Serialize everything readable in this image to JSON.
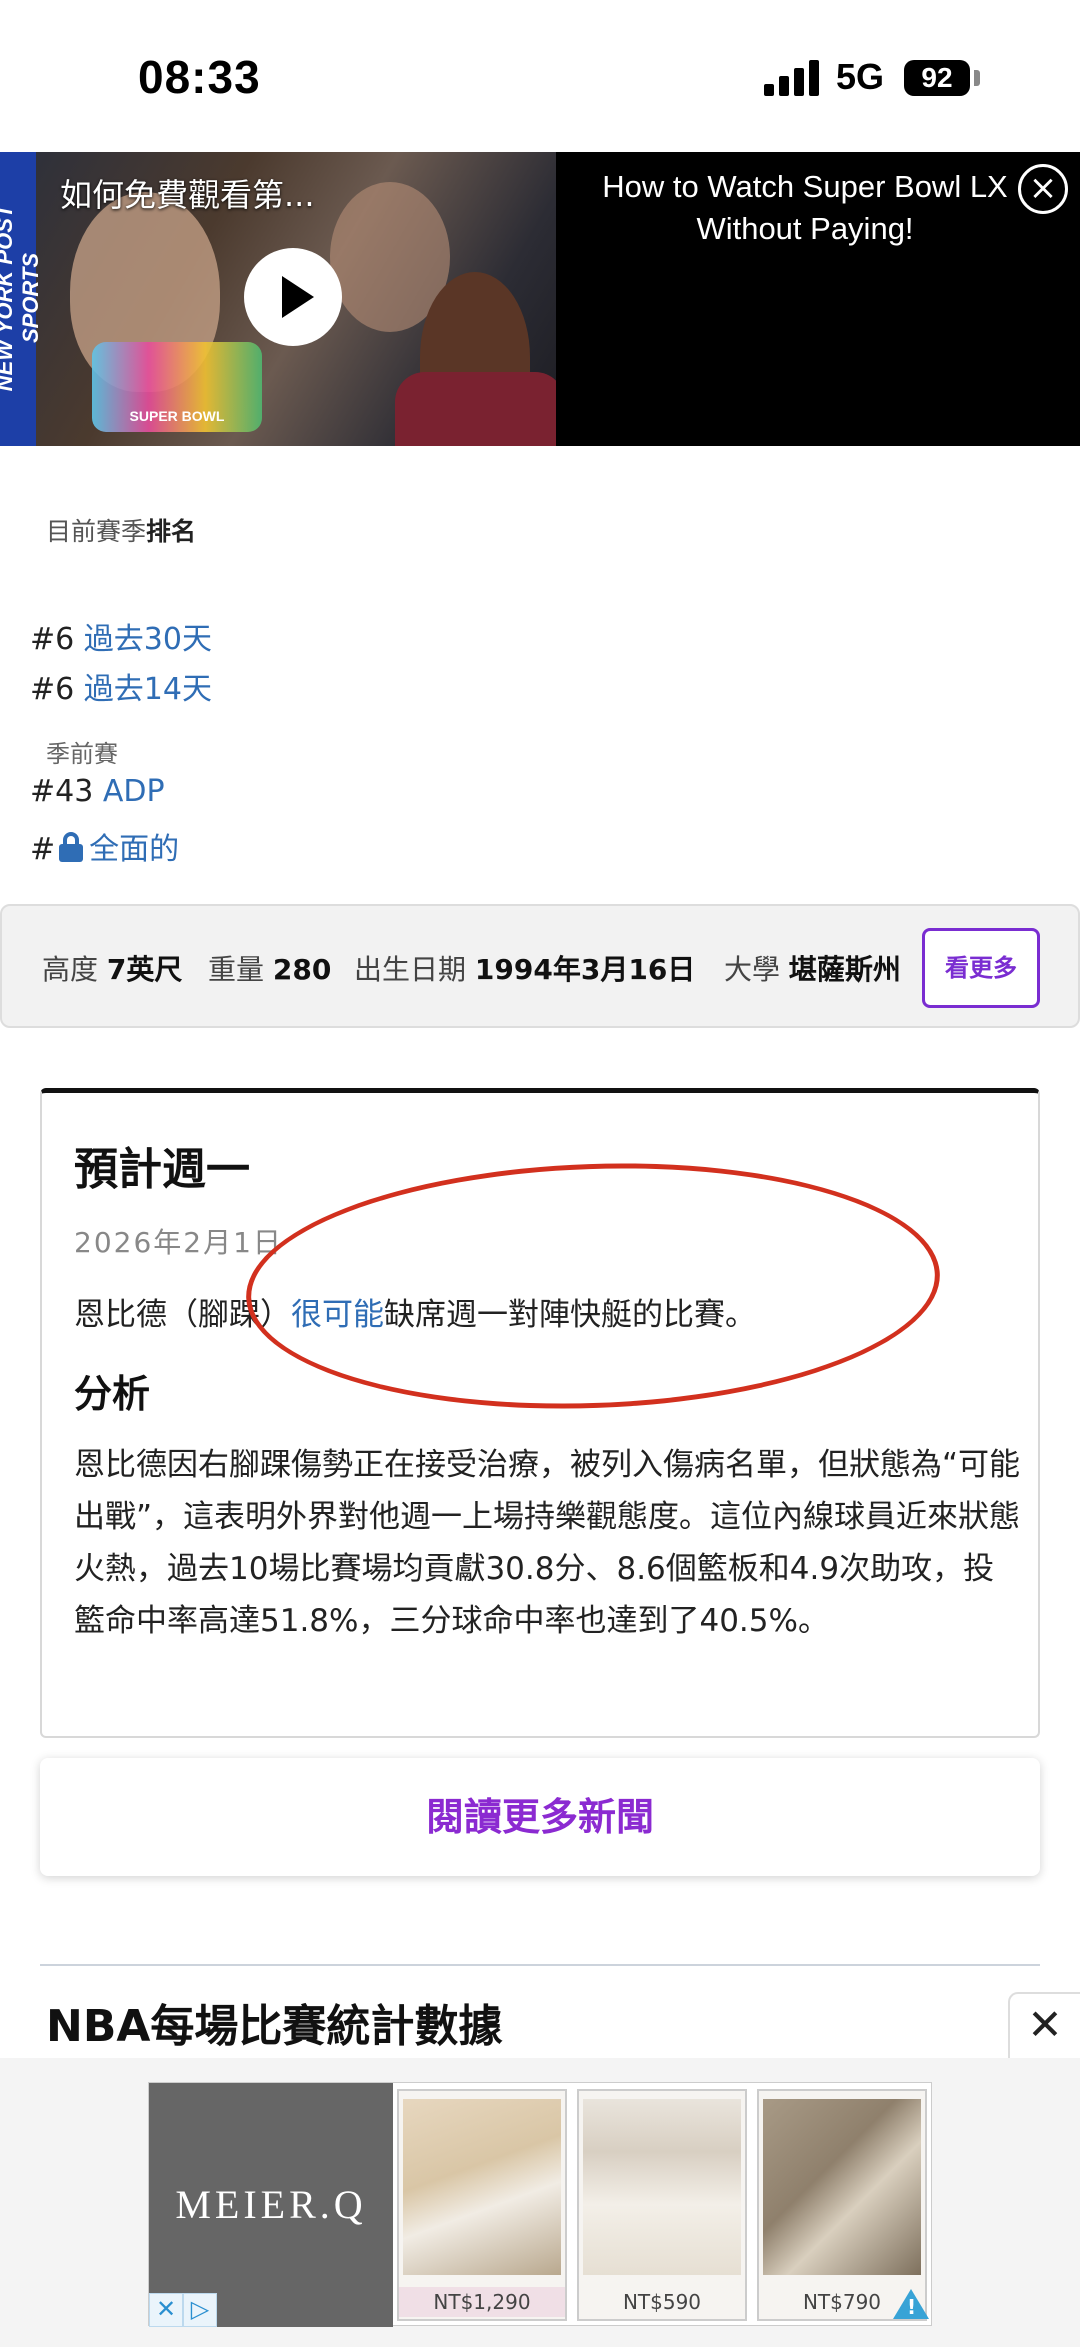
{
  "status_bar": {
    "time": "08:33",
    "network": "5G",
    "battery": "92"
  },
  "video": {
    "overlay_title": "如何免費觀看第...",
    "caption": "How to Watch Super Bowl LX Without Paying!",
    "side_text": "NEW YORK POST SPORTS",
    "logo_text": "SUPER BOWL"
  },
  "rankings": {
    "heading_prefix": "目前賽季",
    "heading_bold": "排名",
    "rows": [
      {
        "rank": "#6",
        "label": "過去30天"
      },
      {
        "rank": "#6",
        "label": "過去14天"
      }
    ],
    "preseason_label": "季前賽",
    "preseason_rows": [
      {
        "rank": "#43",
        "label": "ADP"
      },
      {
        "rank": "#",
        "label": "全面的"
      }
    ]
  },
  "bio": {
    "height_label": "高度",
    "height_value": "7英尺",
    "weight_label": "重量",
    "weight_value": "280",
    "birth_label": "出生日期",
    "birth_value": "1994年3月16日",
    "college_label": "大學",
    "college_value": "堪薩斯州",
    "see_more": "看更多"
  },
  "news": {
    "title": "預計週一",
    "date": "2026年2月1日",
    "line_prefix": "恩比德（腳踝）",
    "line_link": "很可能",
    "line_suffix": "缺席週一對陣快艇的比賽。",
    "analysis_title": "分析",
    "analysis_text": "恩比德因右腳踝傷勢正在接受治療，被列入傷病名單，但狀態為“可能出戰”，這表明外界對他週一上場持樂觀態度。這位內線球員近來狀態火熱，過去10場比賽場均貢獻30.8分、8.6個籃板和4.9次助攻，投籃命中率高達51.8%，三分球命中率也達到了40.5%。"
  },
  "read_more": "閱讀更多新聞",
  "stats_heading": "NBA每場比賽統計數據",
  "ad": {
    "brand": "MEIER.Q",
    "products": [
      {
        "price": "NT$1,290"
      },
      {
        "price": "NT$590"
      },
      {
        "price": "NT$790"
      }
    ]
  },
  "colors": {
    "link": "#2f6db5",
    "accent_purple": "#7a2dd1",
    "annotation_red": "#d2301e"
  }
}
